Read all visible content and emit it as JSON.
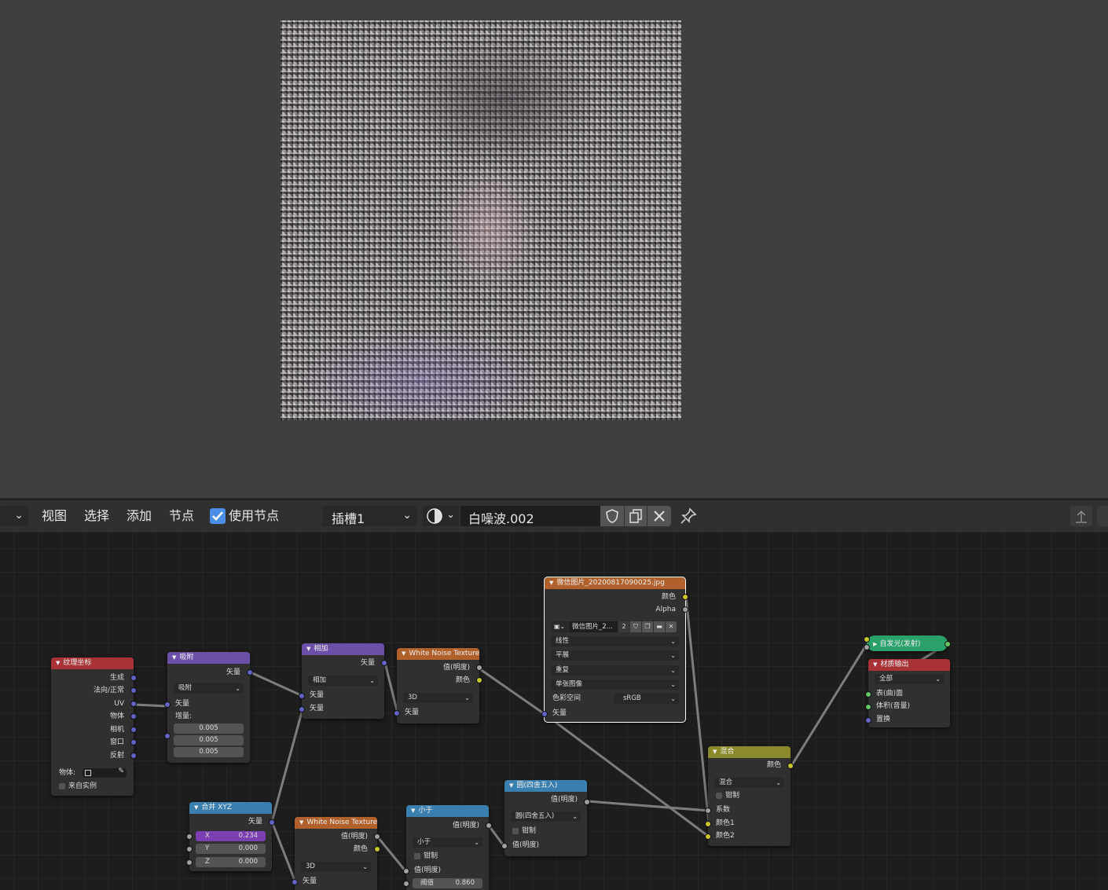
{
  "preview": {
    "alt": ""
  },
  "header": {
    "editor_type_chevron": "⌄",
    "menu": {
      "view": "视图",
      "select": "选择",
      "add": "添加",
      "node": "节点"
    },
    "use_nodes_label": "使用节点",
    "slot": "插槽1",
    "material_name": "白噪波.002"
  },
  "nodes": {
    "tex_coord": {
      "title": "纹理坐标",
      "outputs": [
        "生成",
        "法向/正常",
        "UV",
        "物体",
        "相机",
        "窗口",
        "反射"
      ],
      "object_label": "物体:",
      "from_instancer": "来自实例"
    },
    "snap": {
      "title": "吸附",
      "output": "矢量",
      "mode": "吸附",
      "input": "矢量",
      "increment_label": "增量:",
      "increment": [
        "0.005",
        "0.005",
        "0.005"
      ]
    },
    "add": {
      "title": "相加",
      "output": "矢量",
      "mode": "相加",
      "inputs": [
        "矢量",
        "矢量"
      ]
    },
    "noise1": {
      "title": "White Noise Texture",
      "outputs": [
        "值(明度)",
        "颜色"
      ],
      "dim": "3D",
      "input": "矢量"
    },
    "image": {
      "title": "微信图片_20200817090025.jpg",
      "outputs": [
        "颜色",
        "Alpha"
      ],
      "image_name": "微信图片_2...",
      "users": "2",
      "interp": "线性",
      "projection": "平展",
      "extension": "重复",
      "source": "单张图像",
      "colorspace_label": "色彩空间",
      "colorspace": "sRGB",
      "input": "矢量"
    },
    "emission": {
      "title": "自发光(发射)"
    },
    "output": {
      "title": "材质输出",
      "target": "全部",
      "inputs": [
        "表(曲)面",
        "体积(音量)",
        "置换"
      ]
    },
    "mix": {
      "title": "混合",
      "output": "颜色",
      "mode": "混合",
      "clamp": "钳制",
      "inputs": [
        "系数",
        "颜色1",
        "颜色2"
      ]
    },
    "combine": {
      "title": "合并 XYZ",
      "output": "矢量",
      "x_label": "X",
      "x": "0.234",
      "y_label": "Y",
      "y": "0.000",
      "z_label": "Z",
      "z": "0.000"
    },
    "noise2": {
      "title": "White Noise Texture",
      "outputs": [
        "值(明度)",
        "颜色"
      ],
      "dim": "3D",
      "input": "矢量"
    },
    "less": {
      "title": "小于",
      "output": "值(明度)",
      "mode": "小于",
      "clamp": "钳制",
      "input": "值(明度)",
      "threshold_label": "阈值",
      "threshold": "0.860"
    },
    "round": {
      "title": "圆(四舍五入)",
      "output": "值(明度)",
      "mode": "圆(四舍五入)",
      "clamp": "钳制",
      "input": "值(明度)"
    }
  },
  "colors": {
    "input_node": "#a83236",
    "vector_node": "#6c50a8",
    "texture_node": "#b0602a",
    "converter_node": "#3a7fae",
    "shader_node": "#2aa06a",
    "color_node": "#8a8a2a",
    "accent_checkbox": "#4a8ee8",
    "x_field": "#7a3fb0"
  }
}
